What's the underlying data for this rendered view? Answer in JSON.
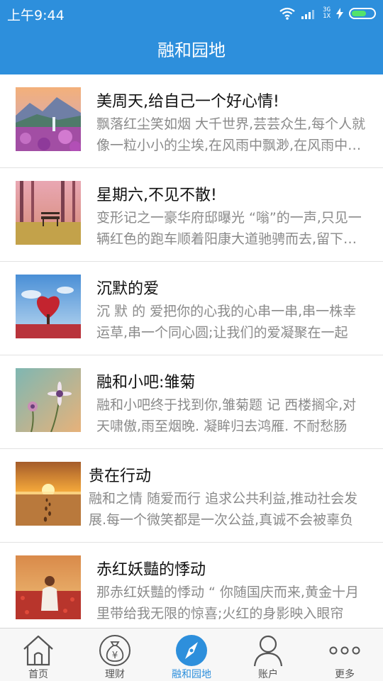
{
  "status": {
    "time": "上午9:44",
    "network_top": "3G",
    "network_bottom": "1X"
  },
  "header": {
    "title": "融和园地"
  },
  "articles": [
    {
      "title": "美周天,给自己一个好心情!",
      "summary": "飘落红尘笑如烟 大千世界,芸芸众生,每个人就像一粒小小的尘埃,在风雨中飘渺,在风雨中飘渺",
      "thumb": "mountain-flowers-image"
    },
    {
      "title": "星期六,不见不散!",
      "summary": "变形记之一豪华府邸曝光 “嗡”的一声,只见一辆红色的跑车顺着阳康大道驰骋而去,留下一路",
      "thumb": "bench-forest-image"
    },
    {
      "title": "沉默的爱",
      "summary": "沉 默 的 爱把你的心我的心串一串,串一株幸运草,串一个同心圆;让我们的爱凝聚在一起",
      "thumb": "heart-tree-image"
    },
    {
      "title": "融和小吧:雏菊",
      "summary": "融和小吧终于找到你,雏菊题 记 西楼搁伞,对天啸傲,雨至烟晚. 凝眸归去鸿雁. 不耐愁肠",
      "thumb": "daisy-flower-image"
    },
    {
      "title": "贵在行动",
      "summary": "融和之情 随爱而行 追求公共利益,推动社会发展.每一个微笑都是一次公益,真诚不会被辜负",
      "thumb": "sunset-footprints-image"
    },
    {
      "title": "赤红妖豔的悸动",
      "summary": "那赤红妖豔的悸动 “ 你随国庆而来,黄金十月里带给我无限的惊喜;火红的身影映入眼帘",
      "thumb": "girl-poppy-field-image"
    }
  ],
  "nav": [
    {
      "label": "首页",
      "icon": "home-icon",
      "active": false
    },
    {
      "label": "理财",
      "icon": "money-bag-icon",
      "active": false
    },
    {
      "label": "融和园地",
      "icon": "compass-icon",
      "active": true
    },
    {
      "label": "账户",
      "icon": "user-icon",
      "active": false
    },
    {
      "label": "更多",
      "icon": "more-dots-icon",
      "active": false
    }
  ],
  "colors": {
    "primary": "#2d8fdc",
    "nav_inactive": "#555555",
    "summary_text": "#8a8a8a",
    "battery": "#54e36b"
  }
}
